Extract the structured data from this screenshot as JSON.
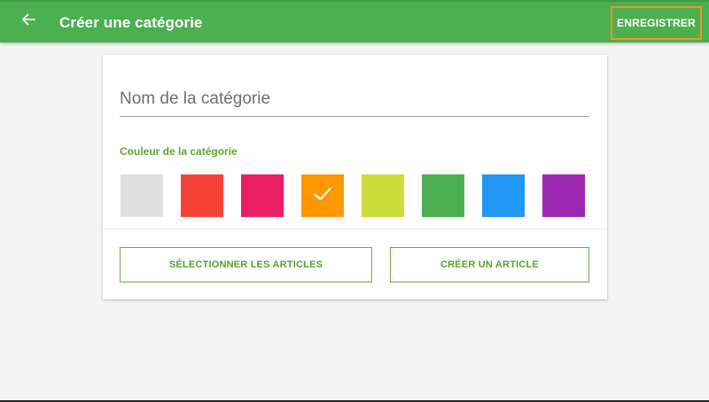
{
  "header": {
    "title": "Créer une catégorie",
    "save_label": "ENREGISTRER",
    "background": "#4caf50"
  },
  "form": {
    "name_placeholder": "Nom de la catégorie",
    "name_value": "",
    "color_label": "Couleur de la catégorie",
    "colors": [
      {
        "hex": "#e0e0e0",
        "selected": false
      },
      {
        "hex": "#f44336",
        "selected": false
      },
      {
        "hex": "#e91e63",
        "selected": false
      },
      {
        "hex": "#ff9800",
        "selected": true
      },
      {
        "hex": "#cddc39",
        "selected": false
      },
      {
        "hex": "#4caf50",
        "selected": false
      },
      {
        "hex": "#2196f3",
        "selected": false
      },
      {
        "hex": "#9c27b0",
        "selected": false
      }
    ]
  },
  "actions": {
    "select_articles_label": "SÉLECTIONNER LES ARTICLES",
    "create_article_label": "CRÉER UN ARTICLE"
  }
}
